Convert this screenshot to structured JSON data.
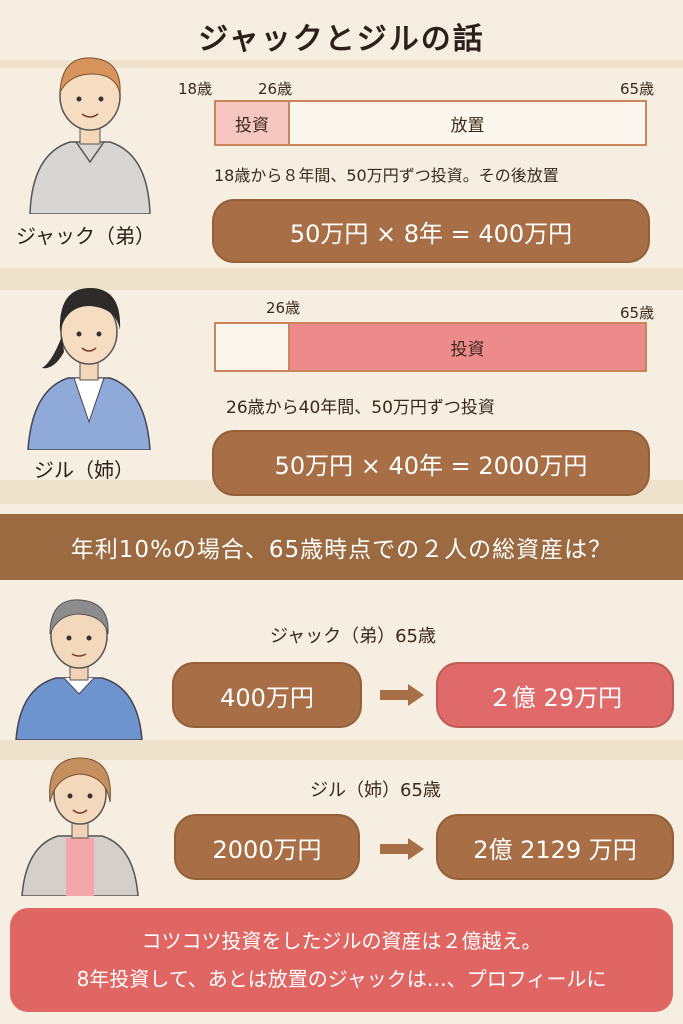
{
  "title": "ジャックとジルの話",
  "jack": {
    "caption": "ジャック（弟）",
    "age_start": "18歳",
    "age_mid": "26歳",
    "age_end": "65歳",
    "bar_invest_label": "投資",
    "bar_hold_label": "放置",
    "description": "18歳から８年間、50万円ずつ投資。その後放置",
    "formula": "50万円 × 8年 = 400万円"
  },
  "jill": {
    "caption": "ジル（姉）",
    "age_mid": "26歳",
    "age_end": "65歳",
    "bar_invest_label": "投資",
    "description": "26歳から40年間、50万円ずつ投資",
    "formula": "50万円 × 40年 = 2000万円"
  },
  "question": "年利10%の場合、65歳時点での２人の総資産は？",
  "result_jack": {
    "heading": "ジャック（弟）65歳",
    "from": "400万円",
    "to": "２億 29万円"
  },
  "result_jill": {
    "heading": "ジル（姉）65歳",
    "from": "2000万円",
    "to": "2億 2129 万円"
  },
  "footer": {
    "line1": "コツコツ投資をしたジルの資産は２億越え。",
    "line2": "8年投資して、あとは放置のジャックは…、プロフィールに"
  },
  "colors": {
    "brown": "#a86e45",
    "red": "#e06a6a",
    "band": "#9b6a40",
    "background": "#f6eee0"
  }
}
